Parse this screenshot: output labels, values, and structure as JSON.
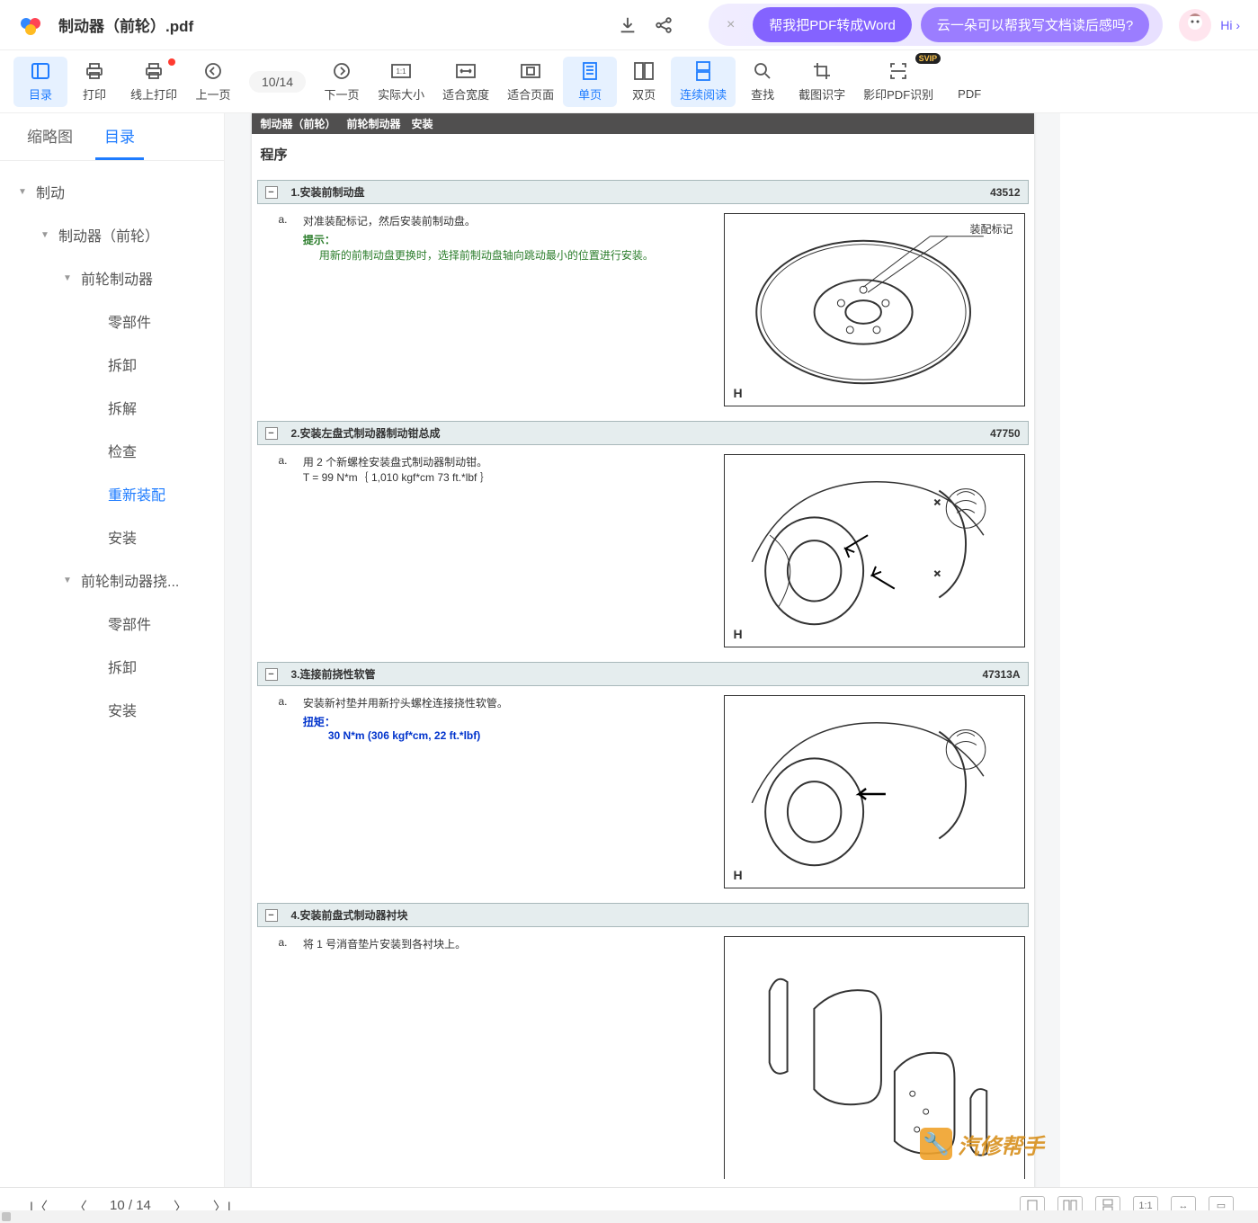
{
  "titlebar": {
    "filename": "制动器（前轮）.pdf",
    "hi_label": "Hi ›"
  },
  "promo": {
    "btn1": "帮我把PDF转成Word",
    "btn2": "云一朵可以帮我写文档读后感吗?"
  },
  "toolbar": {
    "toc": "目录",
    "print": "打印",
    "online_print": "线上打印",
    "prev": "上一页",
    "page_current": "10",
    "page_sep": " / ",
    "page_total": "14",
    "next": "下一页",
    "actual": "实际大小",
    "fitw": "适合宽度",
    "fitp": "适合页面",
    "single": "单页",
    "double": "双页",
    "continuous": "连续阅读",
    "find": "查找",
    "ocr_crop": "截图识字",
    "scan_ocr": "影印PDF识别",
    "pdf_more": "PDF"
  },
  "sidebar": {
    "tab_thumb": "缩略图",
    "tab_toc": "目录",
    "items": [
      {
        "label": "制动",
        "level": 1,
        "tri": "▼"
      },
      {
        "label": "制动器（前轮）",
        "level": 2,
        "tri": "▼"
      },
      {
        "label": "前轮制动器",
        "level": 3,
        "tri": "▼"
      },
      {
        "label": "零部件",
        "level": 4,
        "tri": ""
      },
      {
        "label": "拆卸",
        "level": 4,
        "tri": ""
      },
      {
        "label": "拆解",
        "level": 4,
        "tri": ""
      },
      {
        "label": "检查",
        "level": 4,
        "tri": ""
      },
      {
        "label": "重新装配",
        "level": 4,
        "tri": "",
        "current": true
      },
      {
        "label": "安装",
        "level": 4,
        "tri": ""
      },
      {
        "label": "前轮制动器挠...",
        "level": 3,
        "tri": "▼"
      },
      {
        "label": "零部件",
        "level": 4,
        "tri": ""
      },
      {
        "label": "拆卸",
        "level": 4,
        "tri": ""
      },
      {
        "label": "安装",
        "level": 4,
        "tri": ""
      }
    ]
  },
  "document": {
    "breadcrumb": [
      "制动器（前轮）",
      "前轮制动器",
      "安装"
    ],
    "section_title": "程序",
    "steps": [
      {
        "num": "1.",
        "title": "安装前制动盘",
        "code": "43512",
        "a_mark": "a.",
        "text": "对准装配标记，然后安装前制动盘。",
        "hint_label": "提示：",
        "hint": "用新的前制动盘更换时，选择前制动盘轴向跳动最小的位置进行安装。",
        "callout": "装配标记",
        "fig_h": "H"
      },
      {
        "num": "2.",
        "title": "安装左盘式制动器制动钳总成",
        "code": "47750",
        "a_mark": "a.",
        "text": "用 2 个新螺栓安装盘式制动器制动钳。",
        "text2": "T = 99 N*m｛ 1,010 kgf*cm 73 ft.*lbf ｝",
        "fig_h": "H"
      },
      {
        "num": "3.",
        "title": "连接前挠性软管",
        "code": "47313A",
        "a_mark": "a.",
        "text": "安装新衬垫并用新拧头螺栓连接挠性软管。",
        "torque_label": "扭矩：",
        "torque": "30 N*m (306 kgf*cm, 22 ft.*lbf)",
        "fig_h": "H"
      },
      {
        "num": "4.",
        "title": "安装前盘式制动器衬块",
        "code": "",
        "a_mark": "a.",
        "text": "将 1 号消音垫片安装到各衬块上。"
      }
    ]
  },
  "statusbar": {
    "page_current": "10",
    "page_sep": " / ",
    "page_total": "14"
  },
  "watermark": "汽修帮手"
}
